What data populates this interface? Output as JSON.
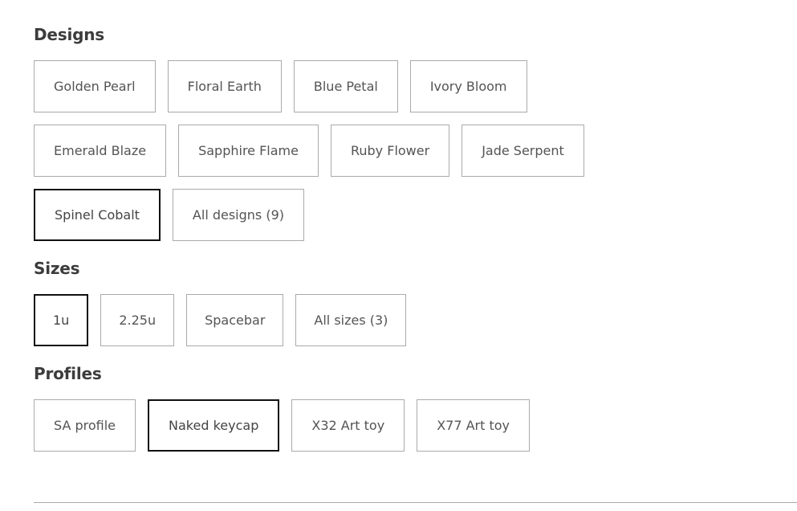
{
  "sections": [
    {
      "id": "designs",
      "heading": "Designs",
      "rows": [
        [
          {
            "label": "Golden Pearl",
            "selected": false
          },
          {
            "label": "Floral Earth",
            "selected": false
          },
          {
            "label": "Blue Petal",
            "selected": false
          },
          {
            "label": "Ivory Bloom",
            "selected": false
          }
        ],
        [
          {
            "label": "Emerald Blaze",
            "selected": false
          },
          {
            "label": "Sapphire Flame",
            "selected": false
          },
          {
            "label": "Ruby Flower",
            "selected": false
          },
          {
            "label": "Jade Serpent",
            "selected": false
          }
        ],
        [
          {
            "label": "Spinel Cobalt",
            "selected": true
          },
          {
            "label": "All designs (9)",
            "selected": false
          }
        ]
      ]
    },
    {
      "id": "sizes",
      "heading": "Sizes",
      "rows": [
        [
          {
            "label": "1u",
            "selected": true
          },
          {
            "label": "2.25u",
            "selected": false
          },
          {
            "label": "Spacebar",
            "selected": false
          },
          {
            "label": "All sizes (3)",
            "selected": false
          }
        ]
      ]
    },
    {
      "id": "profiles",
      "heading": "Profiles",
      "rows": [
        [
          {
            "label": "SA profile",
            "selected": false
          },
          {
            "label": "Naked keycap",
            "selected": false
          },
          {
            "label": "X32 Art toy",
            "selected": false
          },
          {
            "label": "X77 Art toy",
            "selected": false
          }
        ]
      ]
    }
  ],
  "selected_profile": "Naked keycap",
  "colors": {
    "heading_text": "#3c3c3c",
    "option_text": "#545454",
    "option_border": "#aaaaaa",
    "option_border_selected": "#101010",
    "background": "#ffffff",
    "divider": "#a9a9a9"
  }
}
